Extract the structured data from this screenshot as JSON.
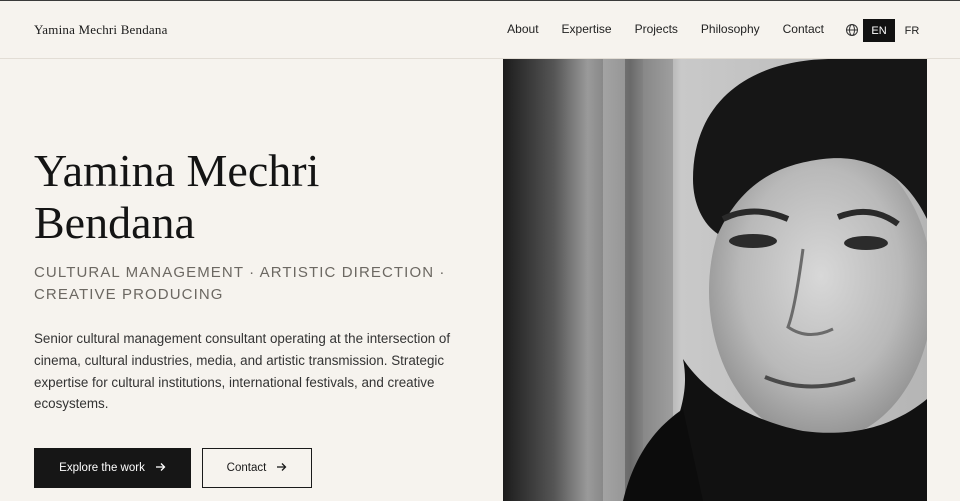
{
  "header": {
    "brand": "Yamina Mechri Bendana",
    "nav": [
      "About",
      "Expertise",
      "Projects",
      "Philosophy",
      "Contact"
    ],
    "lang_active": "EN",
    "lang_other": "FR"
  },
  "hero": {
    "title_line1": "Yamina Mechri",
    "title_line2": "Bendana",
    "tagline": "Cultural management · Artistic direction · Creative producing",
    "description": "Senior cultural management consultant operating at the intersection of cinema, cultural industries, media, and artistic transmission. Strategic expertise for cultural institutions, international festivals, and creative ecosystems.",
    "cta_primary": "Explore the work",
    "cta_secondary": "Contact"
  },
  "icons": {
    "language": "globe-icon",
    "arrow": "arrow-right-icon"
  }
}
